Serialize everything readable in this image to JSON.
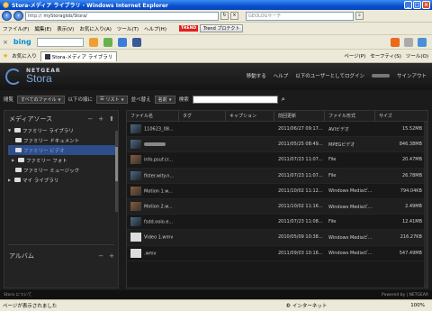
{
  "window": {
    "title": "Stora-メディア ライブラリ - Windows Internet Explorer"
  },
  "addressbar": {
    "url_prefix": "http://",
    "url": "myStoraglob/Stora/",
    "search_placeholder": "GEOLOGサーチ"
  },
  "menubar": {
    "items": [
      "ファイル(F)",
      "編集(E)",
      "表示(V)",
      "お気に入り(A)",
      "ツール(T)",
      "ヘルプ(H)"
    ],
    "trend_logo": "TREND",
    "trend_button": "Trend プロテクト"
  },
  "bingbar": {
    "logo": "bing"
  },
  "favorites": {
    "label": "お気に入り",
    "tab": "Stora-メディア ライブラリ",
    "right_items": [
      "ページ(P)",
      "セーフティ(S)",
      "ツール(O)"
    ]
  },
  "app": {
    "brand": "NETGEAR",
    "product": "Stora",
    "nav": [
      "移動する",
      "ヘルプ",
      "以下のユーザーとしてログイン",
      "サインアウト"
    ],
    "toolbar": {
      "view_label": "閲覧",
      "view_value": "すべてのファイル",
      "group_label": "以下の順に",
      "list_value": "リスト",
      "sort_label": "並べ替え",
      "sort_value": "名前",
      "search_label": "検索"
    },
    "sidebar": {
      "media_title": "メディアソース",
      "tree": [
        {
          "label": "ファミリー ライブラリ",
          "level": 0,
          "expanded": true
        },
        {
          "label": "ファミリー ドキュメント",
          "level": 1
        },
        {
          "label": "ファミリー ビデオ",
          "level": 1,
          "selected": true
        },
        {
          "label": "ファミリー フォト",
          "level": 1,
          "collapsed": true
        },
        {
          "label": "ファミリー ミュージック",
          "level": 1
        },
        {
          "label": "マイ ライブラリ",
          "level": 0,
          "collapsed": true
        }
      ],
      "album_title": "アルバム"
    },
    "table": {
      "columns": [
        "ファイル名",
        "タグ",
        "キャプション",
        "前回更新",
        "ファイル形式",
        "サイズ"
      ],
      "rows": [
        {
          "name": "110623_08...",
          "tag": "",
          "caption": "",
          "updated": "2011/06/27 09:17...",
          "type": "AVIビデオ",
          "size": "15.52MB"
        },
        {
          "name": "",
          "tag": "",
          "caption": "",
          "updated": "2011/05/25 08:49...",
          "type": "MPEGビデオ",
          "size": "846.38MB"
        },
        {
          "name": "info.psuf.cr...",
          "tag": "",
          "caption": "",
          "updated": "2011/07/23 11:07...",
          "type": "File",
          "size": "20.47MB"
        },
        {
          "name": "fister.wity.n...",
          "tag": "",
          "caption": "",
          "updated": "2011/07/23 11:07...",
          "type": "File",
          "size": "26.78MB"
        },
        {
          "name": "Motion 1.w...",
          "tag": "",
          "caption": "",
          "updated": "2011/10/02 11:12...",
          "type": "Windows Mediaビ...",
          "size": "794.04KB"
        },
        {
          "name": "Motion 2.w...",
          "tag": "",
          "caption": "",
          "updated": "2011/10/02 11:16...",
          "type": "Windows Mediaビ...",
          "size": "2.49MB"
        },
        {
          "name": "fsdd.ooio.e...",
          "tag": "",
          "caption": "",
          "updated": "2011/07/23 11:08...",
          "type": "File",
          "size": "12.41MB"
        },
        {
          "name": "Video 1.wmv",
          "tag": "",
          "caption": "",
          "updated": "2010/05/09 10:38...",
          "type": "Windows Mediaビ...",
          "size": "216.27KB"
        },
        {
          "name": ".wmv",
          "tag": "",
          "caption": "",
          "updated": "2011/09/03 10:16...",
          "type": "Windows Mediaビ...",
          "size": "547.49MB"
        }
      ]
    },
    "footer": {
      "left": "Stora について",
      "right": "Powered by | NETGEAR"
    }
  },
  "statusbar": {
    "status": "ページが表示されました",
    "zone": "インターネット",
    "zoom": "100%"
  }
}
